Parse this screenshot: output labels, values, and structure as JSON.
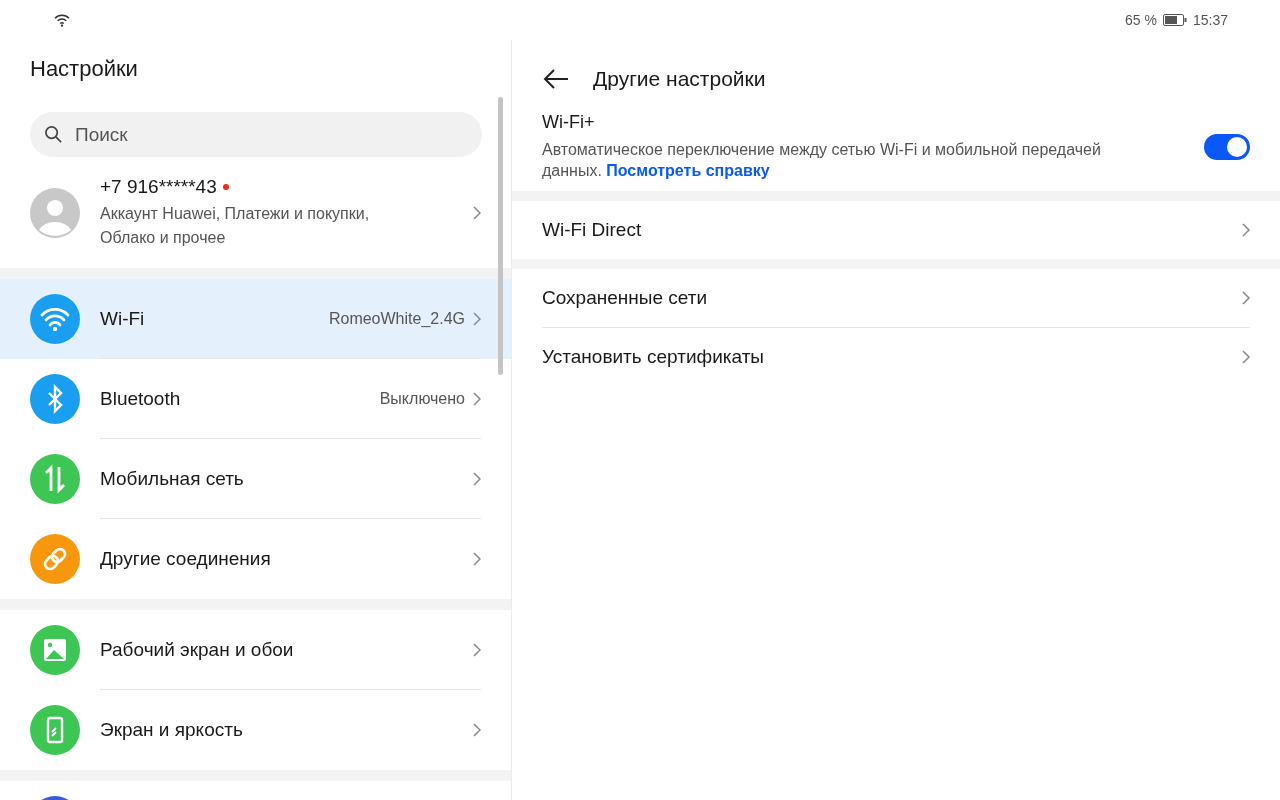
{
  "status_bar": {
    "battery": "65 %",
    "time": "15:37"
  },
  "settings": {
    "title": "Настройки",
    "search": {
      "placeholder": "Поиск"
    },
    "account": {
      "phone": "+7 916*****43",
      "notification": true,
      "subtitle": "Аккаунт Huawei, Платежи и покупки, Облако и прочее"
    },
    "groups": [
      [
        {
          "label": "Wi-Fi",
          "value": "RomeoWhite_2.4G",
          "selected": true,
          "color": "#1a9ff0"
        },
        {
          "label": "Bluetooth",
          "value": "Выключено",
          "selected": false,
          "color": "#1a9ff0"
        },
        {
          "label": "Мобильная сеть",
          "selected": false,
          "color": "#3dc653"
        },
        {
          "label": "Другие соединения",
          "selected": false,
          "color": "#f7970e"
        }
      ],
      [
        {
          "label": "Рабочий экран и обои",
          "selected": false,
          "color": "#3dc653"
        },
        {
          "label": "Экран и яркость",
          "selected": false,
          "color": "#3dc653"
        }
      ]
    ]
  },
  "detail": {
    "title": "Другие настройки",
    "wifi_plus": {
      "title": "Wi-Fi+",
      "description": "Автоматическое переключение между сетью Wi-Fi и мобильной передачей данных.",
      "link": "Посмотреть справку",
      "on": true
    },
    "sections": [
      [
        {
          "label": "Wi-Fi Direct"
        }
      ],
      [
        {
          "label": "Сохраненные сети"
        },
        {
          "label": "Установить сертификаты"
        }
      ]
    ]
  }
}
